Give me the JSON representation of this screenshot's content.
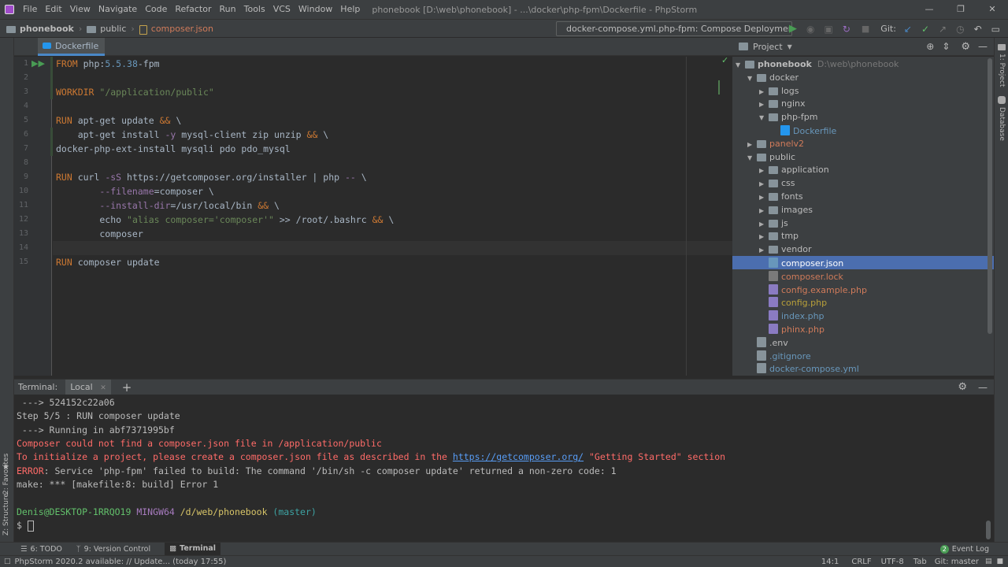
{
  "menu": {
    "items": [
      "File",
      "Edit",
      "View",
      "Navigate",
      "Code",
      "Refactor",
      "Run",
      "Tools",
      "VCS",
      "Window",
      "Help"
    ],
    "app_title": "phonebook [D:\\web\\phonebook] - ...\\docker\\php-fpm\\Dockerfile - PhpStorm"
  },
  "navbar": {
    "crumbs": [
      "phonebook",
      "public",
      "composer.json"
    ],
    "run_config": "docker-compose.yml.php-fpm: Compose Deployment",
    "git_label": "Git:"
  },
  "editor": {
    "tab": "Dockerfile",
    "line_numbers": [
      "1",
      "2",
      "3",
      "4",
      "5",
      "6",
      "7",
      "8",
      "9",
      "10",
      "11",
      "12",
      "13",
      "14",
      "15"
    ],
    "lines": {
      "l1_kw": "FROM",
      "l1_rest": " php:",
      "l1_num": "5.5.38",
      "l1_tail": "-fpm",
      "l3_kw": "WORKDIR",
      "l3_str": " \"/application/public\"",
      "l5_kw": "RUN",
      "l5_rest": " apt-get update ",
      "l5_op": "&&",
      "l5_tail": " \\",
      "l6_a": "    apt-get install ",
      "l6_flag": "-y",
      "l6_b": " mysql-client zip unzip ",
      "l6_op": "&&",
      "l6_tail": " \\",
      "l7": "docker-php-ext-install mysqli pdo pdo_mysql",
      "l9_kw": "RUN",
      "l9_a": " curl ",
      "l9_flag": "-sS",
      "l9_b": " https://getcomposer.org/installer | php ",
      "l9_flag2": "--",
      "l9_tail": " \\",
      "l10_a": "        ",
      "l10_flag": "--filename",
      "l10_b": "=composer \\",
      "l11_a": "        ",
      "l11_flag": "--install-dir",
      "l11_b": "=/usr/local/bin ",
      "l11_op": "&&",
      "l11_tail": " \\",
      "l12_a": "        echo ",
      "l12_str": "\"alias composer='composer'\"",
      "l12_b": " >> /root/.bashrc ",
      "l12_op": "&&",
      "l12_tail": " \\",
      "l13": "        composer",
      "l15_kw": "RUN",
      "l15_rest": " composer update"
    }
  },
  "project": {
    "title": "Project",
    "tree": [
      {
        "name": "phonebook",
        "path": "D:\\web\\phonebook",
        "level": 0,
        "type": "folder",
        "open": true
      },
      {
        "name": "docker",
        "level": 1,
        "type": "folder",
        "open": true
      },
      {
        "name": "logs",
        "level": 2,
        "type": "folder",
        "open": false
      },
      {
        "name": "nginx",
        "level": 2,
        "type": "folder",
        "open": false
      },
      {
        "name": "php-fpm",
        "level": 2,
        "type": "folder",
        "open": true
      },
      {
        "name": "Dockerfile",
        "level": 3,
        "type": "docker"
      },
      {
        "name": "panelv2",
        "level": 1,
        "type": "folder",
        "open": false
      },
      {
        "name": "public",
        "level": 1,
        "type": "folder",
        "open": true
      },
      {
        "name": "application",
        "level": 2,
        "type": "folder",
        "open": false
      },
      {
        "name": "css",
        "level": 2,
        "type": "folder",
        "open": false
      },
      {
        "name": "fonts",
        "level": 2,
        "type": "folder",
        "open": false
      },
      {
        "name": "images",
        "level": 2,
        "type": "folder",
        "open": false
      },
      {
        "name": "js",
        "level": 2,
        "type": "folder",
        "open": false
      },
      {
        "name": "tmp",
        "level": 2,
        "type": "folder",
        "open": false
      },
      {
        "name": "vendor",
        "level": 2,
        "type": "folder",
        "open": false
      },
      {
        "name": "composer.json",
        "level": 2,
        "type": "json",
        "selected": true
      },
      {
        "name": "composer.lock",
        "level": 2,
        "type": "lock"
      },
      {
        "name": "config.example.php",
        "level": 2,
        "type": "php"
      },
      {
        "name": "config.php",
        "level": 2,
        "type": "php"
      },
      {
        "name": "index.php",
        "level": 2,
        "type": "php"
      },
      {
        "name": "phinx.php",
        "level": 2,
        "type": "php"
      },
      {
        "name": ".env",
        "level": 1,
        "type": "text"
      },
      {
        "name": ".gitignore",
        "level": 1,
        "type": "text"
      },
      {
        "name": "docker-compose.yml",
        "level": 1,
        "type": "yml"
      }
    ]
  },
  "terminal": {
    "label": "Terminal:",
    "tab": "Local",
    "l1": " ---> 524152c22a06",
    "l2": "Step 5/5 : RUN composer update",
    "l3": " ---> Running in abf7371995bf",
    "l4": "Composer could not find a composer.json file in /application/public",
    "l5a": "To initialize a project, please create a composer.json file as described in the ",
    "l5link": "https://getcomposer.org/",
    "l5b": " \"Getting Started\" section",
    "l6a": "ERROR",
    "l6b": ": Service 'php-fpm' failed to build: The command '/bin/sh -c composer update' returned a non-zero code: 1",
    "l7": "make: *** [makefile:8: build] Error 1",
    "p_user": "Denis@DESKTOP-1RRQO19",
    "p_sys": " MINGW64",
    "p_path": " /d/web/phonebook",
    "p_branch": " (master)",
    "p_dollar": "$ "
  },
  "side": {
    "left": [
      "2: Favorites",
      "Z: Structure"
    ],
    "right": [
      "1: Project",
      "Database"
    ]
  },
  "tools": {
    "todo": "6: TODO",
    "vcs": "9: Version Control",
    "terminal": "Terminal",
    "event_log": "Event Log",
    "event_count": "2"
  },
  "status": {
    "message": "PhpStorm 2020.2 available: // Update... (today 17:55)",
    "pos": "14:1",
    "crlf": "CRLF",
    "enc": "UTF-8",
    "indent": "Tab",
    "git": "Git: master"
  },
  "colors": {
    "accent": "#4a88c7",
    "selection": "#4b6eaf",
    "run_green": "#499c54"
  }
}
